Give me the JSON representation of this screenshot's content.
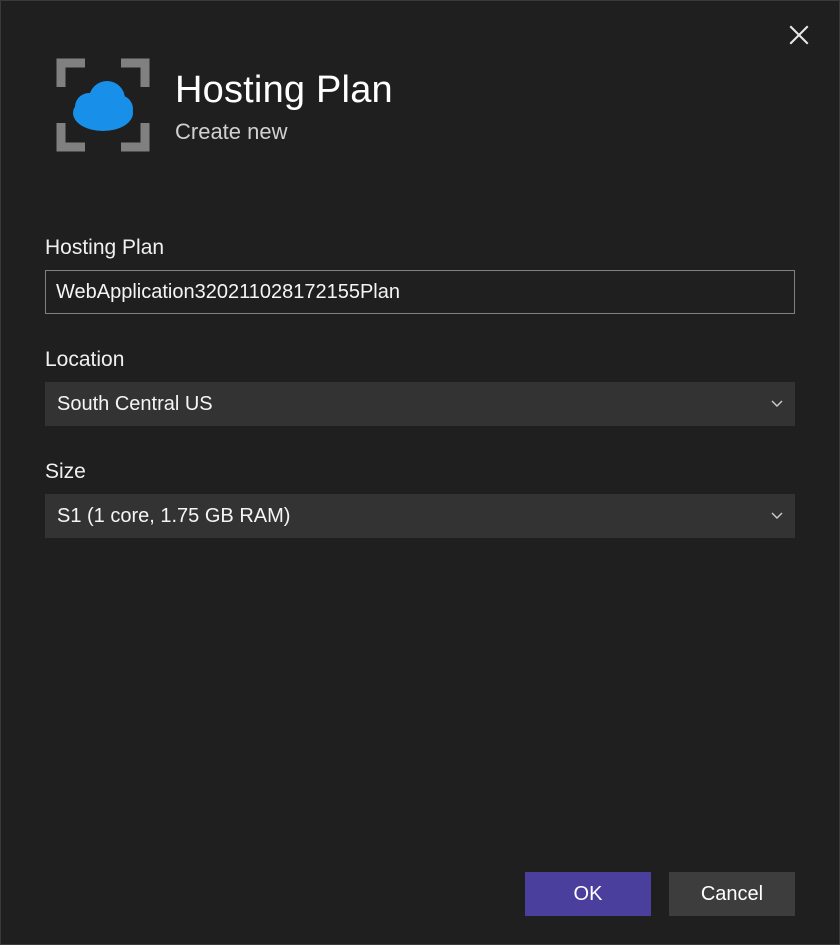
{
  "header": {
    "title": "Hosting Plan",
    "subtitle": "Create new"
  },
  "form": {
    "plan": {
      "label": "Hosting Plan",
      "value": "WebApplication320211028172155Plan"
    },
    "location": {
      "label": "Location",
      "value": "South Central US"
    },
    "size": {
      "label": "Size",
      "value": "S1 (1 core, 1.75 GB RAM)"
    }
  },
  "buttons": {
    "ok": "OK",
    "cancel": "Cancel"
  }
}
